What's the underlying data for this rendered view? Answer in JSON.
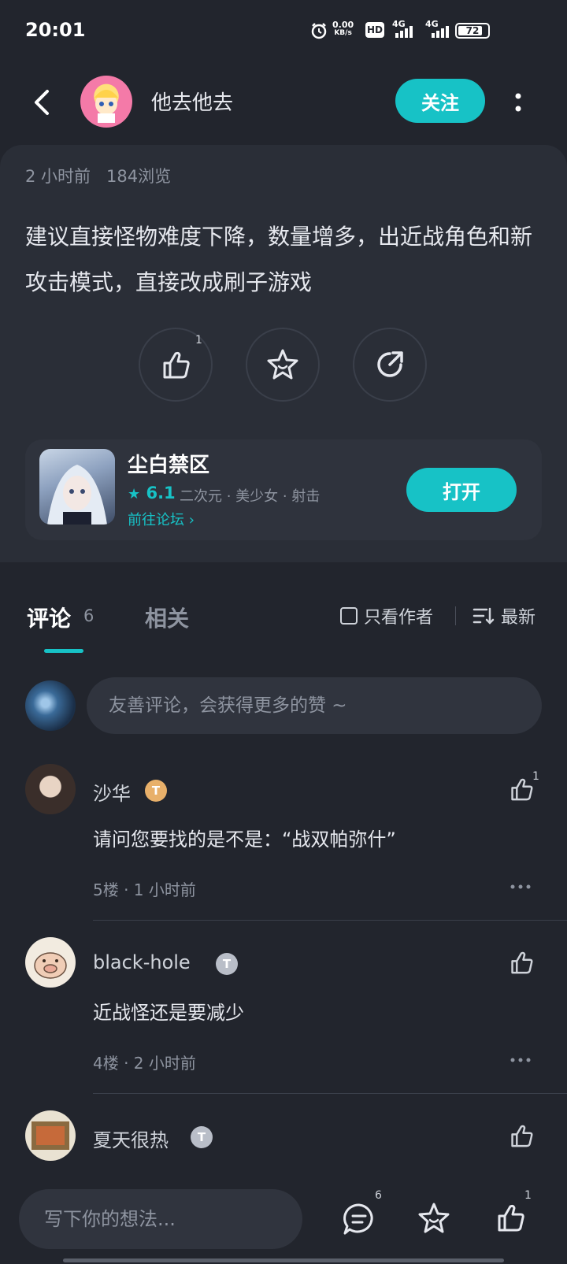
{
  "status_bar": {
    "time": "20:01",
    "net_speed": "0.00",
    "net_unit": "KB/s",
    "hd": "HD",
    "signal1": "4G",
    "signal2": "4G",
    "battery": "72"
  },
  "header": {
    "author_name": "他去他去",
    "follow_label": "关注"
  },
  "post": {
    "meta": "2 小时前   184浏览",
    "body": "建议直接怪物难度下降，数量增多，出近战角色和新攻击模式，直接改成刷子游戏",
    "like_count": "1"
  },
  "game": {
    "name": "尘白禁区",
    "rating": "6.1",
    "tags": "二次元 · 美少女 · 射击",
    "forum_link": "前往论坛",
    "open_label": "打开"
  },
  "tabs": {
    "comments_label": "评论",
    "comments_count": "6",
    "related_label": "相关"
  },
  "filters": {
    "only_author": "只看作者",
    "sort": "最新"
  },
  "comment_input": {
    "placeholder": "友善评论，会获得更多的赞 ~"
  },
  "comments": [
    {
      "name": "沙华",
      "badge": "T",
      "text": "请问您要找的是不是：“战双帕弥什”",
      "meta": "5楼 · 1 小时前",
      "likes": "1",
      "badge_color": "#e8b06a"
    },
    {
      "name": "black-hole",
      "badge": "T",
      "text": "近战怪还是要减少",
      "meta": "4楼 · 2 小时前",
      "likes": "",
      "badge_color": "#b9bec8"
    },
    {
      "name": "夏天很热",
      "badge": "T",
      "text": "",
      "meta": "",
      "likes": "",
      "badge_color": "#b9bec8"
    }
  ],
  "bottom_bar": {
    "placeholder": "写下你的想法...",
    "comment_count": "6",
    "like_count": "1"
  },
  "colors": {
    "accent": "#17c2c6",
    "background": "#22252d",
    "card": "#2a2e37"
  }
}
